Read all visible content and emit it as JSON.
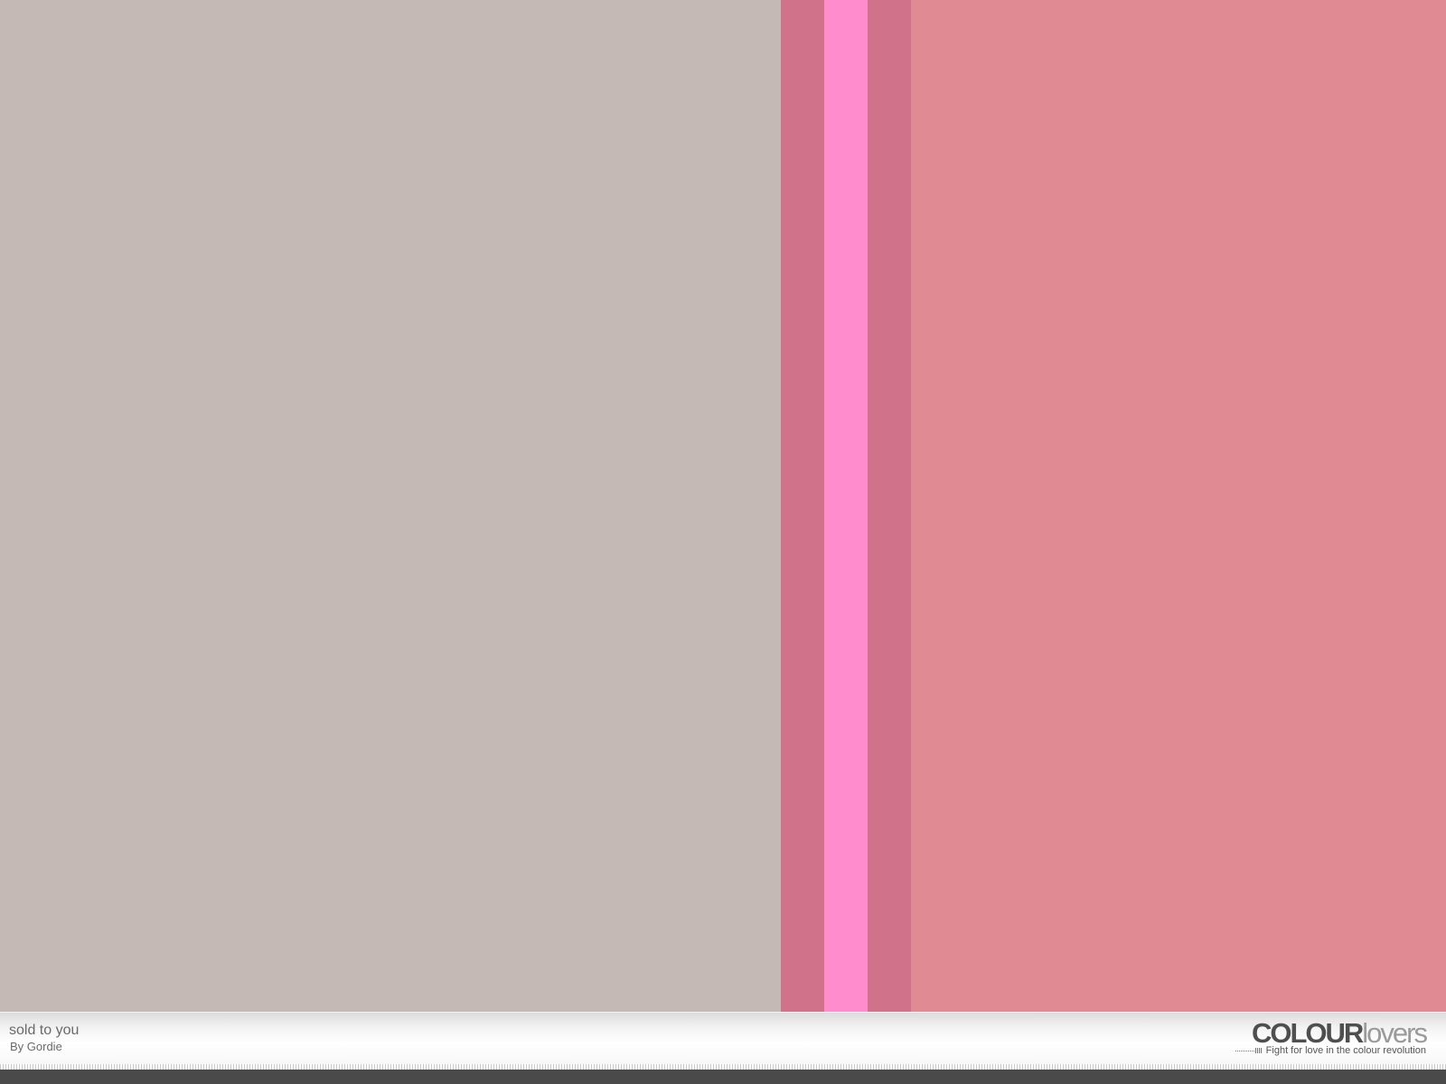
{
  "palette": {
    "title": "sold to you",
    "author": "By Gordie",
    "colors": [
      {
        "hex": "#C5B9B5",
        "share": 0.54
      },
      {
        "hex": "#D07289",
        "share": 0.03
      },
      {
        "hex": "#FF8DCE",
        "share": 0.03
      },
      {
        "hex": "#D07289",
        "share": 0.03
      },
      {
        "hex": "#E08A93",
        "share": 0.37
      }
    ]
  },
  "brand": {
    "name_bold": "COLOUR",
    "name_light": "lovers",
    "tagline": "Fight for love in the colour revolution"
  }
}
